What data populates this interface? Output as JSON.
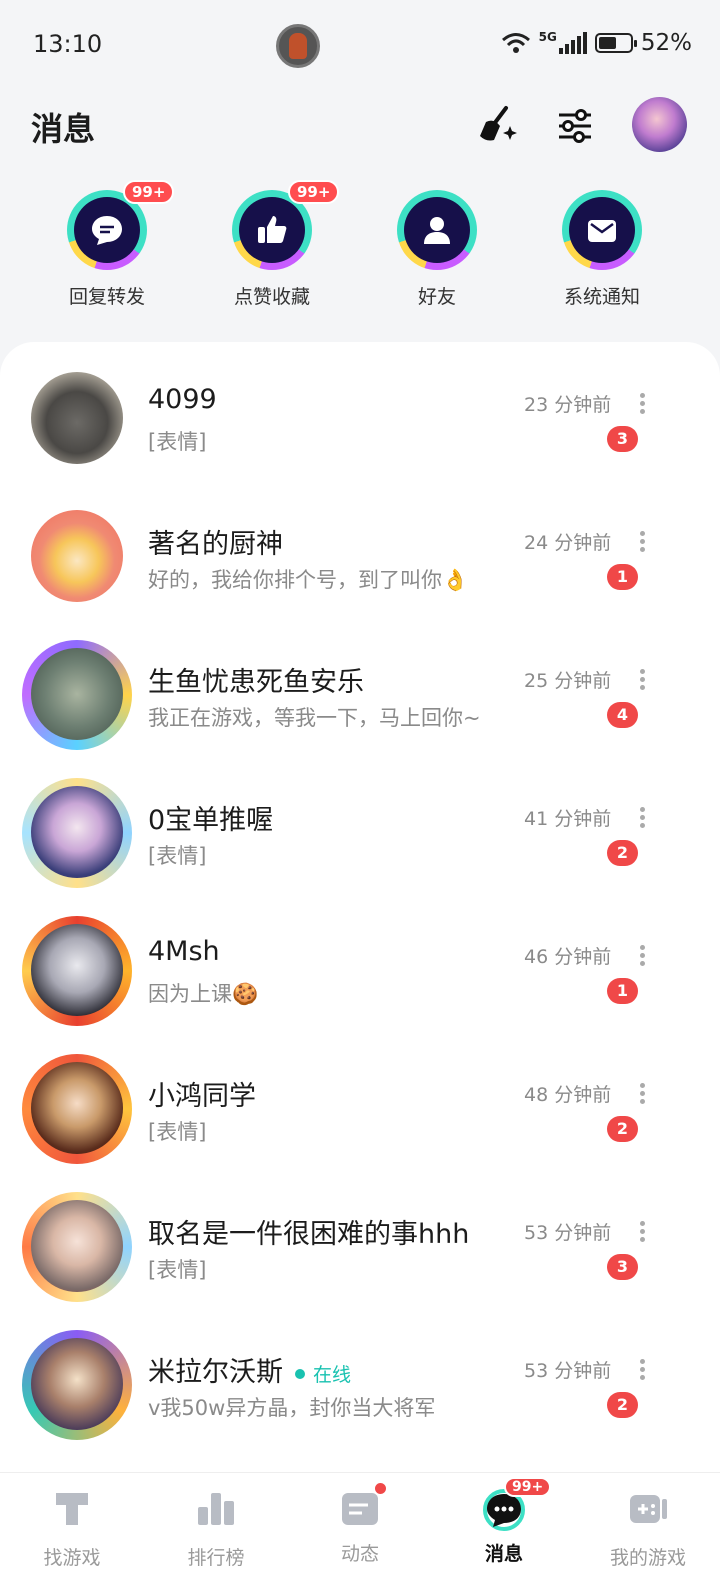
{
  "status_bar": {
    "time": "13:10",
    "network": "5G",
    "battery": "52%"
  },
  "header": {
    "title": "消息"
  },
  "quick_actions": [
    {
      "label": "回复转发",
      "badge": "99+",
      "icon": "chat-bubble-icon"
    },
    {
      "label": "点赞收藏",
      "badge": "99+",
      "icon": "thumbs-up-icon"
    },
    {
      "label": "好友",
      "badge": "",
      "icon": "person-icon"
    },
    {
      "label": "系统通知",
      "badge": "",
      "icon": "envelope-icon"
    }
  ],
  "conversations": [
    {
      "name": "4099",
      "preview": "[表情]",
      "time": "23 分钟前",
      "unread": "3",
      "online": ""
    },
    {
      "name": "著名的厨神",
      "preview": "好的，我给你排个号，到了叫你👌",
      "time": "24 分钟前",
      "unread": "1",
      "online": ""
    },
    {
      "name": "生鱼忧患死鱼安乐",
      "preview": "我正在游戏，等我一下，马上回你~",
      "time": "25 分钟前",
      "unread": "4",
      "online": ""
    },
    {
      "name": "0宝单推喔",
      "preview": "[表情]",
      "time": "41 分钟前",
      "unread": "2",
      "online": ""
    },
    {
      "name": "4Msh",
      "preview": "因为上课🍪",
      "time": "46 分钟前",
      "unread": "1",
      "online": ""
    },
    {
      "name": "小鸿同学",
      "preview": "[表情]",
      "time": "48 分钟前",
      "unread": "2",
      "online": ""
    },
    {
      "name": "取名是一件很困难的事hhh",
      "preview": "[表情]",
      "time": "53 分钟前",
      "unread": "3",
      "online": ""
    },
    {
      "name": "米拉尔沃斯",
      "preview": "v我50w异方晶，封你当大将军",
      "time": "53 分钟前",
      "unread": "2",
      "online": "在线"
    }
  ],
  "tabs": [
    {
      "label": "找游戏",
      "badge": ""
    },
    {
      "label": "排行榜",
      "badge": ""
    },
    {
      "label": "动态",
      "badge": ""
    },
    {
      "label": "消息",
      "badge": "99+"
    },
    {
      "label": "我的游戏",
      "badge": ""
    }
  ],
  "colors": {
    "accent": "#19c2b0",
    "badge_red": "#f04848",
    "quick_icon_bg": "#16104a"
  }
}
